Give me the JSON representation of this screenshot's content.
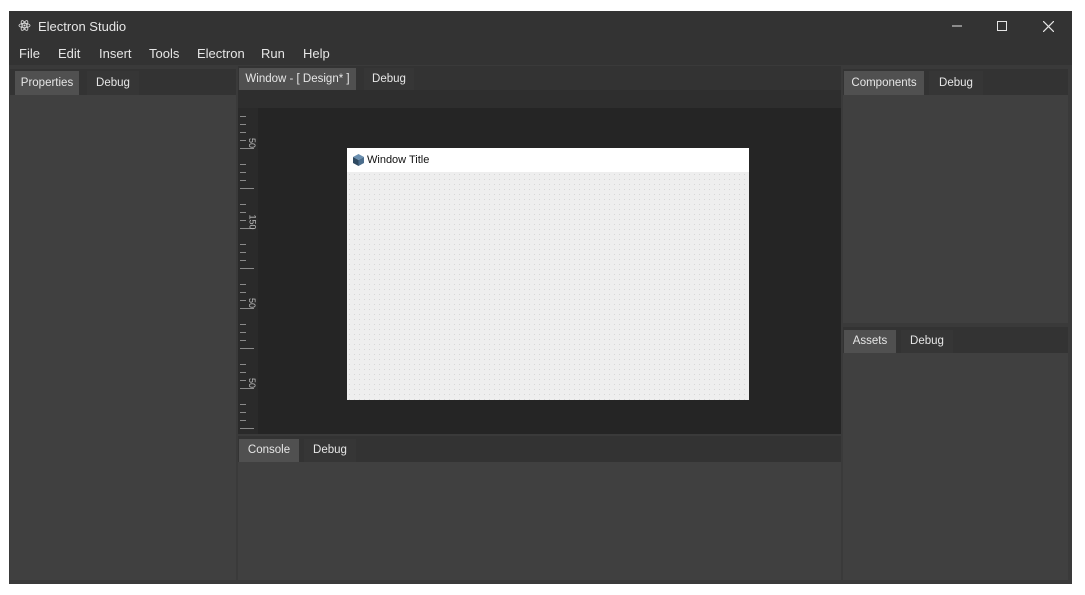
{
  "app": {
    "title": "Electron Studio"
  },
  "window_controls": {
    "minimize": "minimize",
    "maximize": "maximize",
    "close": "close"
  },
  "menu": [
    "File",
    "Edit",
    "Insert",
    "Tools",
    "Electron",
    "Run",
    "Help"
  ],
  "left_panel": {
    "tabs": [
      "Properties",
      "Debug"
    ]
  },
  "center_panel": {
    "tabs": [
      "Window - [ Design* ]",
      "Debug"
    ]
  },
  "ruler": {
    "labels": [
      "50",
      "150",
      "50",
      "50"
    ]
  },
  "design_window": {
    "title": "Window Title"
  },
  "console_panel": {
    "tabs": [
      "Console",
      "Debug"
    ]
  },
  "components_panel": {
    "tabs": [
      "Components",
      "Debug"
    ]
  },
  "assets_panel": {
    "tabs": [
      "Assets",
      "Debug"
    ]
  },
  "colors": {
    "background": "#3a3a3a",
    "panel": "#404040",
    "canvas": "#252525",
    "titlebar": "#333333"
  },
  "icons": [
    "electron-logo-icon",
    "minimize-icon",
    "maximize-icon",
    "close-icon",
    "cube-icon"
  ]
}
